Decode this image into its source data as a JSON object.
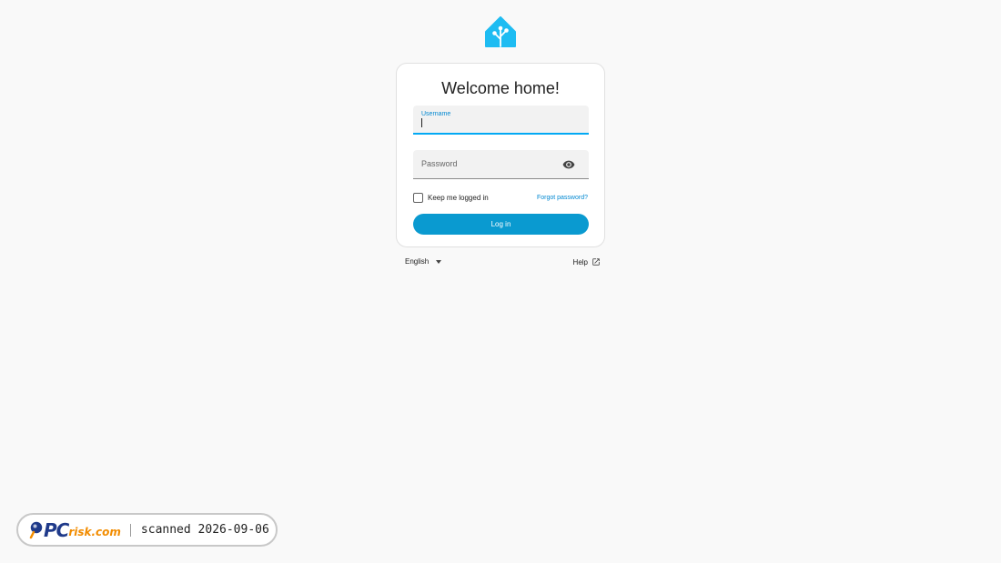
{
  "app": {
    "logo_icon": "home-assistant-logo",
    "brand_color": "#1ebcf2"
  },
  "login": {
    "title": "Welcome home!",
    "username_label": "Username",
    "username_value": "",
    "password_label": "Password",
    "password_value": "",
    "show_password_icon": "eye-icon",
    "remember_label": "Keep me logged in",
    "remember_checked": false,
    "forgot_label": "Forgot password?",
    "login_label": "Log in",
    "accent_color": "#0a9ad0"
  },
  "footer": {
    "language": "English",
    "language_icon": "caret-down-icon",
    "help_label": "Help",
    "help_icon": "open-in-new-icon"
  },
  "watermark": {
    "brand_pc": "PC",
    "brand_risk": "risk.com",
    "scanned_text": "scanned 2026-09-06"
  }
}
